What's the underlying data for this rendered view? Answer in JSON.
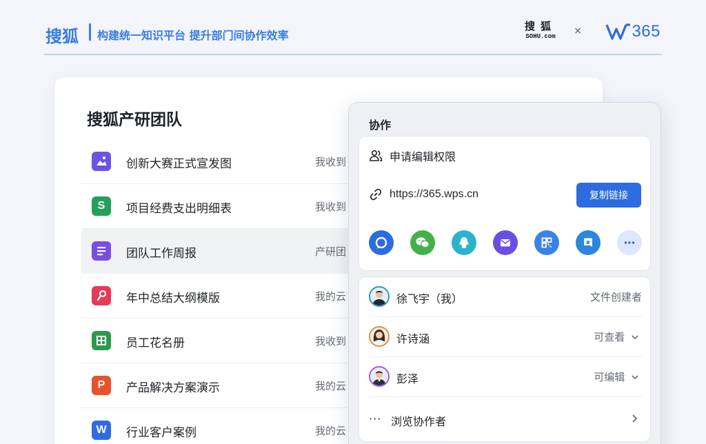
{
  "header": {
    "brand": "搜狐",
    "tagline": "构建统一知识平台 提升部门间协作效率",
    "sohu_logo_top": "搜狐",
    "sohu_logo_bottom": "SOHU.com",
    "times": "×",
    "wps_logo": "365"
  },
  "files_card": {
    "title": "搜狐产研团队",
    "files": [
      {
        "name": "创新大赛正式宣发图",
        "source": "我收到",
        "icon": "image-file-icon",
        "color": "#6b53e6",
        "glyph": ""
      },
      {
        "name": "项目经费支出明细表",
        "source": "我收到",
        "icon": "spreadsheet-file-icon",
        "color": "#23a15a",
        "glyph": "S"
      },
      {
        "name": "团队工作周报",
        "source": "产研团",
        "icon": "document-file-icon",
        "color": "#7a4fe0",
        "glyph": ""
      },
      {
        "name": "年中总结大纲模版",
        "source": "我的云",
        "icon": "mindmap-file-icon",
        "color": "#e63a55",
        "glyph": ""
      },
      {
        "name": "员工花名册",
        "source": "我收到",
        "icon": "table-file-icon",
        "color": "#2c9a4e",
        "glyph": ""
      },
      {
        "name": "产品解决方案演示",
        "source": "我的云",
        "icon": "presentation-file-icon",
        "color": "#e8522d",
        "glyph": "P"
      },
      {
        "name": "行业客户案例",
        "source": "我的云",
        "icon": "word-file-icon",
        "color": "#2f6be2",
        "glyph": "W"
      }
    ]
  },
  "panel": {
    "title": "协作",
    "request_edit": "申请编辑权限",
    "link": "https://365.wps.cn",
    "copy_button": "复制链接",
    "share_targets": [
      {
        "icon": "chat-share-icon",
        "color": "#2d6be0"
      },
      {
        "icon": "wechat-share-icon",
        "color": "#43b14a"
      },
      {
        "icon": "qq-share-icon",
        "color": "#2ab4c9"
      },
      {
        "icon": "mail-share-icon",
        "color": "#6a4fe3"
      },
      {
        "icon": "qrcode-share-icon",
        "color": "#3a82e8"
      },
      {
        "icon": "star-share-icon",
        "color": "#2a86e0"
      },
      {
        "icon": "more-share-icon",
        "color": "#dce7fb"
      }
    ],
    "collaborators": [
      {
        "name": "徐飞宇（我）",
        "role": "文件创建者",
        "has_dropdown": false,
        "border": "#2f9aa8"
      },
      {
        "name": "许诗涵",
        "role": "可查看",
        "has_dropdown": true,
        "border": "#e0913a"
      },
      {
        "name": "彭泽",
        "role": "可编辑",
        "has_dropdown": true,
        "border": "#9b5de0"
      }
    ],
    "browse": "浏览协作者",
    "browse_dots": "···"
  }
}
